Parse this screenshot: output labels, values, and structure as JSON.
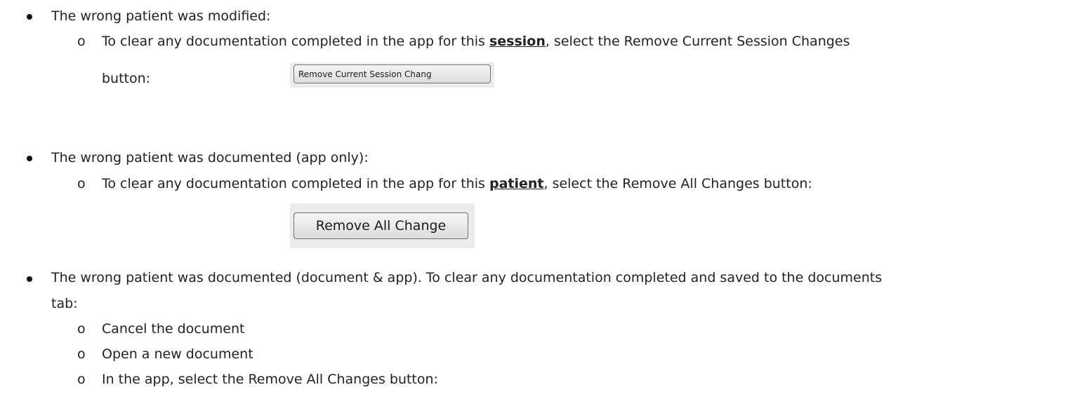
{
  "section1": {
    "heading": "The wrong patient was modified:",
    "sub_marker": "o",
    "instr_before": "To clear any documentation completed in the app for this ",
    "instr_emph": "session",
    "instr_after": ", select the Remove Current Session Changes",
    "instr_line2": "button:",
    "button_label": "Remove  Current  Session Chang"
  },
  "section2": {
    "heading": "The wrong patient was documented (app only):",
    "sub_marker": "o",
    "instr_before": "To clear any documentation completed in the app for this ",
    "instr_emph": "patient",
    "instr_after": ", select the Remove All Changes button:",
    "button_label": "Remove  All Change"
  },
  "section3": {
    "heading_line1": "The wrong patient was documented (document & app).  To clear any documentation completed and saved to the documents",
    "heading_line2": "tab:",
    "steps": [
      {
        "marker": "o",
        "text": "Cancel the document"
      },
      {
        "marker": "o",
        "text": "Open a new document"
      },
      {
        "marker": "o",
        "text": "In the app, select the Remove All Changes button:"
      }
    ]
  }
}
